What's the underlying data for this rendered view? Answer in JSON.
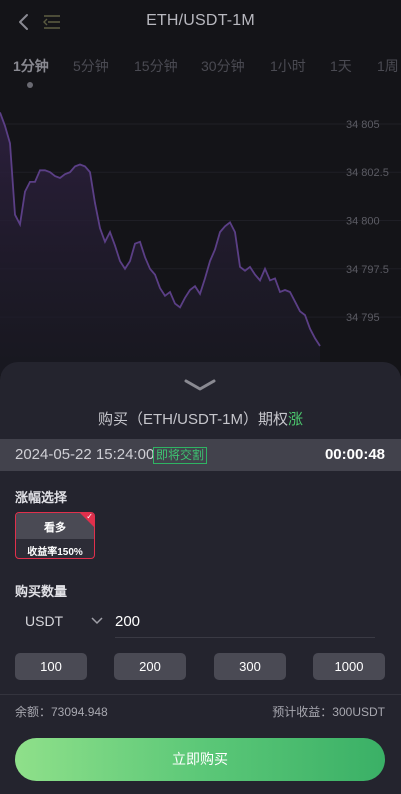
{
  "header": {
    "title": "ETH/USDT-1M",
    "back_icon": "chevron-left-icon",
    "menu_icon": "list-menu-icon"
  },
  "tabs": [
    {
      "label": "1分钟",
      "active": true
    },
    {
      "label": "5分钟"
    },
    {
      "label": "15分钟"
    },
    {
      "label": "30分钟"
    },
    {
      "label": "1小时"
    },
    {
      "label": "1天"
    },
    {
      "label": "1周"
    }
  ],
  "chart_data": {
    "type": "area",
    "title": "",
    "y_tick_labels": [
      "34 805",
      "34 802.5",
      "34 800",
      "34 797.5",
      "34 795"
    ],
    "ylim": [
      34792.0,
      34806.5
    ],
    "x": [
      0,
      1,
      2,
      3,
      4,
      5,
      6,
      7,
      8,
      9,
      10,
      11,
      12,
      13,
      14,
      15,
      16,
      17,
      18,
      19,
      20,
      21,
      22,
      23,
      24,
      25,
      26,
      27,
      28,
      29,
      30,
      31,
      32,
      33,
      34,
      35,
      36,
      37,
      38,
      39,
      40,
      41,
      42,
      43,
      44,
      45,
      46,
      47,
      48,
      49,
      50,
      51,
      52,
      53,
      54,
      55,
      56,
      57,
      58,
      59,
      60,
      61,
      62,
      63,
      64
    ],
    "values": [
      34805.6,
      34804.9,
      34804.0,
      34800.3,
      34799.8,
      34801.5,
      34802.0,
      34802.0,
      34802.6,
      34802.6,
      34802.5,
      34802.3,
      34802.2,
      34802.4,
      34802.5,
      34802.8,
      34802.9,
      34802.8,
      34802.5,
      34800.9,
      34799.6,
      34798.9,
      34799.4,
      34798.7,
      34797.9,
      34797.5,
      34797.9,
      34798.8,
      34798.9,
      34798.1,
      34797.5,
      34797.2,
      34796.5,
      34796.1,
      34796.3,
      34795.7,
      34795.5,
      34796.0,
      34796.4,
      34796.6,
      34796.2,
      34797.0,
      34797.9,
      34798.5,
      34799.4,
      34799.7,
      34799.9,
      34799.4,
      34797.6,
      34797.4,
      34797.6,
      34797.2,
      34796.9,
      34797.5,
      34796.9,
      34797.0,
      34796.3,
      34796.4,
      34796.3,
      34795.8,
      34795.3,
      34795.1,
      34794.4,
      34793.9,
      34793.5
    ],
    "xlabel": "",
    "ylabel": "",
    "grid": true,
    "line_color": "#5b3f86"
  },
  "purchase": {
    "title_prefix": "购买（ETH/USDT-1M）期权",
    "title_direction": "涨",
    "datetime": "2024-05-22 15:24:00",
    "badge": "即将交割",
    "countdown": "00:00:48",
    "range_label": "涨幅选择",
    "option_name": "看多",
    "option_rate": "收益率150%",
    "quantity_label": "购买数量",
    "currency": "USDT",
    "amount": "200",
    "quick_amounts": [
      "100",
      "200",
      "300",
      "1000"
    ],
    "balance": "余额：73094.948",
    "expected": "预计收益：300USDT",
    "buy_label": "立即购买"
  },
  "colors": {
    "accent_green": "#3ec472",
    "danger": "#e0304c",
    "sheet_bg": "#24242e",
    "page_bg": "#141418"
  }
}
